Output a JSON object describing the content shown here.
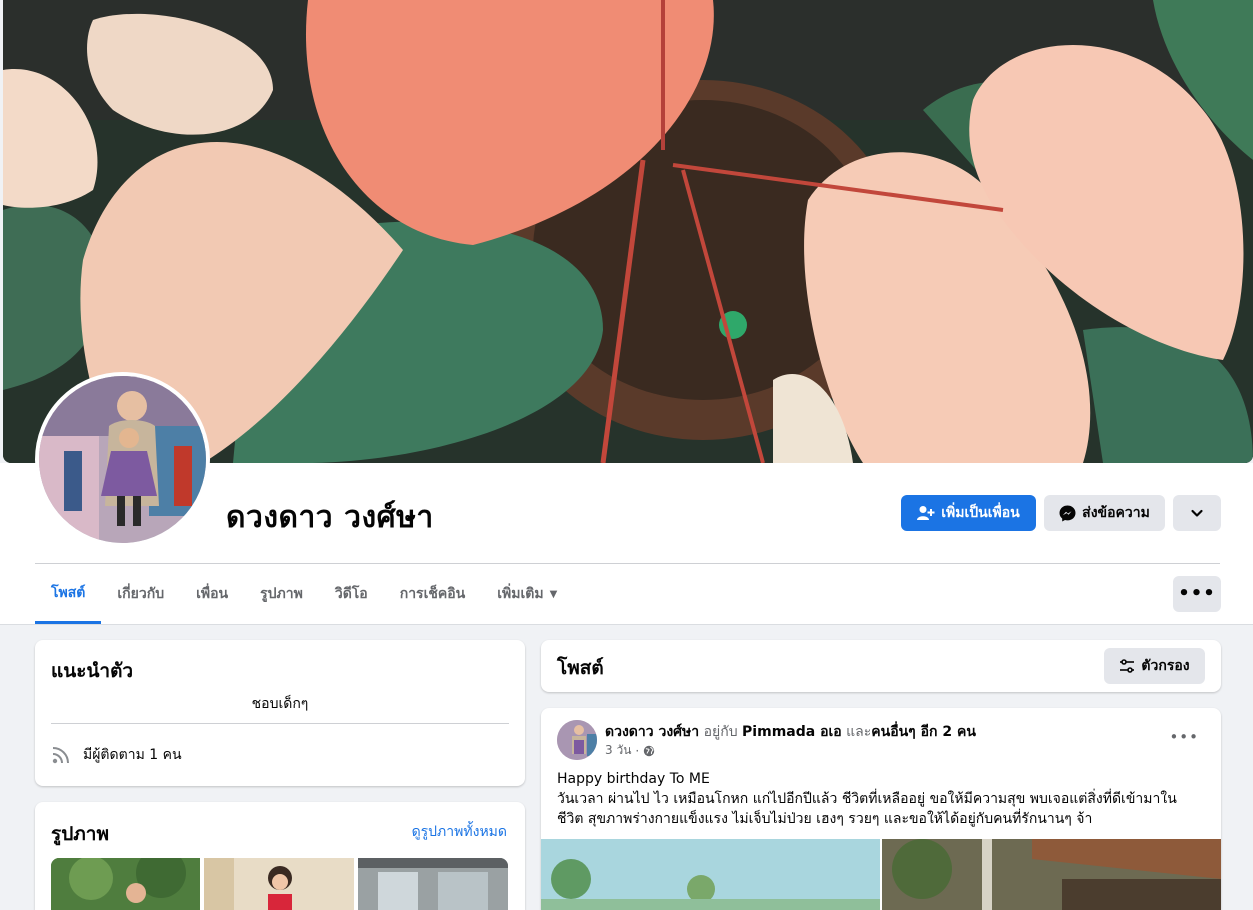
{
  "profile": {
    "name": "ดวงดาว วงศ์ษา"
  },
  "actions": {
    "add_friend": "เพิ่มเป็นเพื่อน",
    "message": "ส่งข้อความ"
  },
  "tabs": [
    {
      "label": "โพสต์"
    },
    {
      "label": "เกี่ยวกับ"
    },
    {
      "label": "เพื่อน"
    },
    {
      "label": "รูปภาพ"
    },
    {
      "label": "วิดีโอ"
    },
    {
      "label": "การเช็คอิน"
    },
    {
      "label": "เพิ่มเติม"
    }
  ],
  "intro": {
    "title": "แนะนำตัว",
    "bio": "ชอบเด็กๆ",
    "followers": "มีผู้ติดตาม 1 คน"
  },
  "photos": {
    "title": "รูปภาพ",
    "see_all": "ดูรูปภาพทั้งหมด"
  },
  "posts_header": {
    "title": "โพสต์",
    "filter": "ตัวกรอง"
  },
  "post": {
    "author": "ดวงดาว วงศ์ษา",
    "with_text": "อยู่กับ",
    "tagged": "Pimmada อเอ",
    "and_text": "และ",
    "others": "คนอื่นๆ อีก 2 คน",
    "time": "3 วัน",
    "text_line1": "Happy birthday To ME",
    "text_line2": "วันเวลา ผ่านไป ไว เหมือนโกหก แก่ไปอีกปีแล้ว ชีวิตที่เหลืออยู่ ขอให้มีความสุข พบเจอแต่สิ่งที่ดีเข้ามาใน",
    "text_line3": "ชีวิต สุขภาพร่างกายแข็งแรง ไม่เจ็บไม่ป่วย เฮงๆ รวยๆ  และขอให้ได้อยู่กับคนที่รักนานๆ จ้า"
  },
  "colors": {
    "accent": "#1b74e4",
    "background": "#f0f2f5",
    "button_grey": "#e4e6eb"
  }
}
